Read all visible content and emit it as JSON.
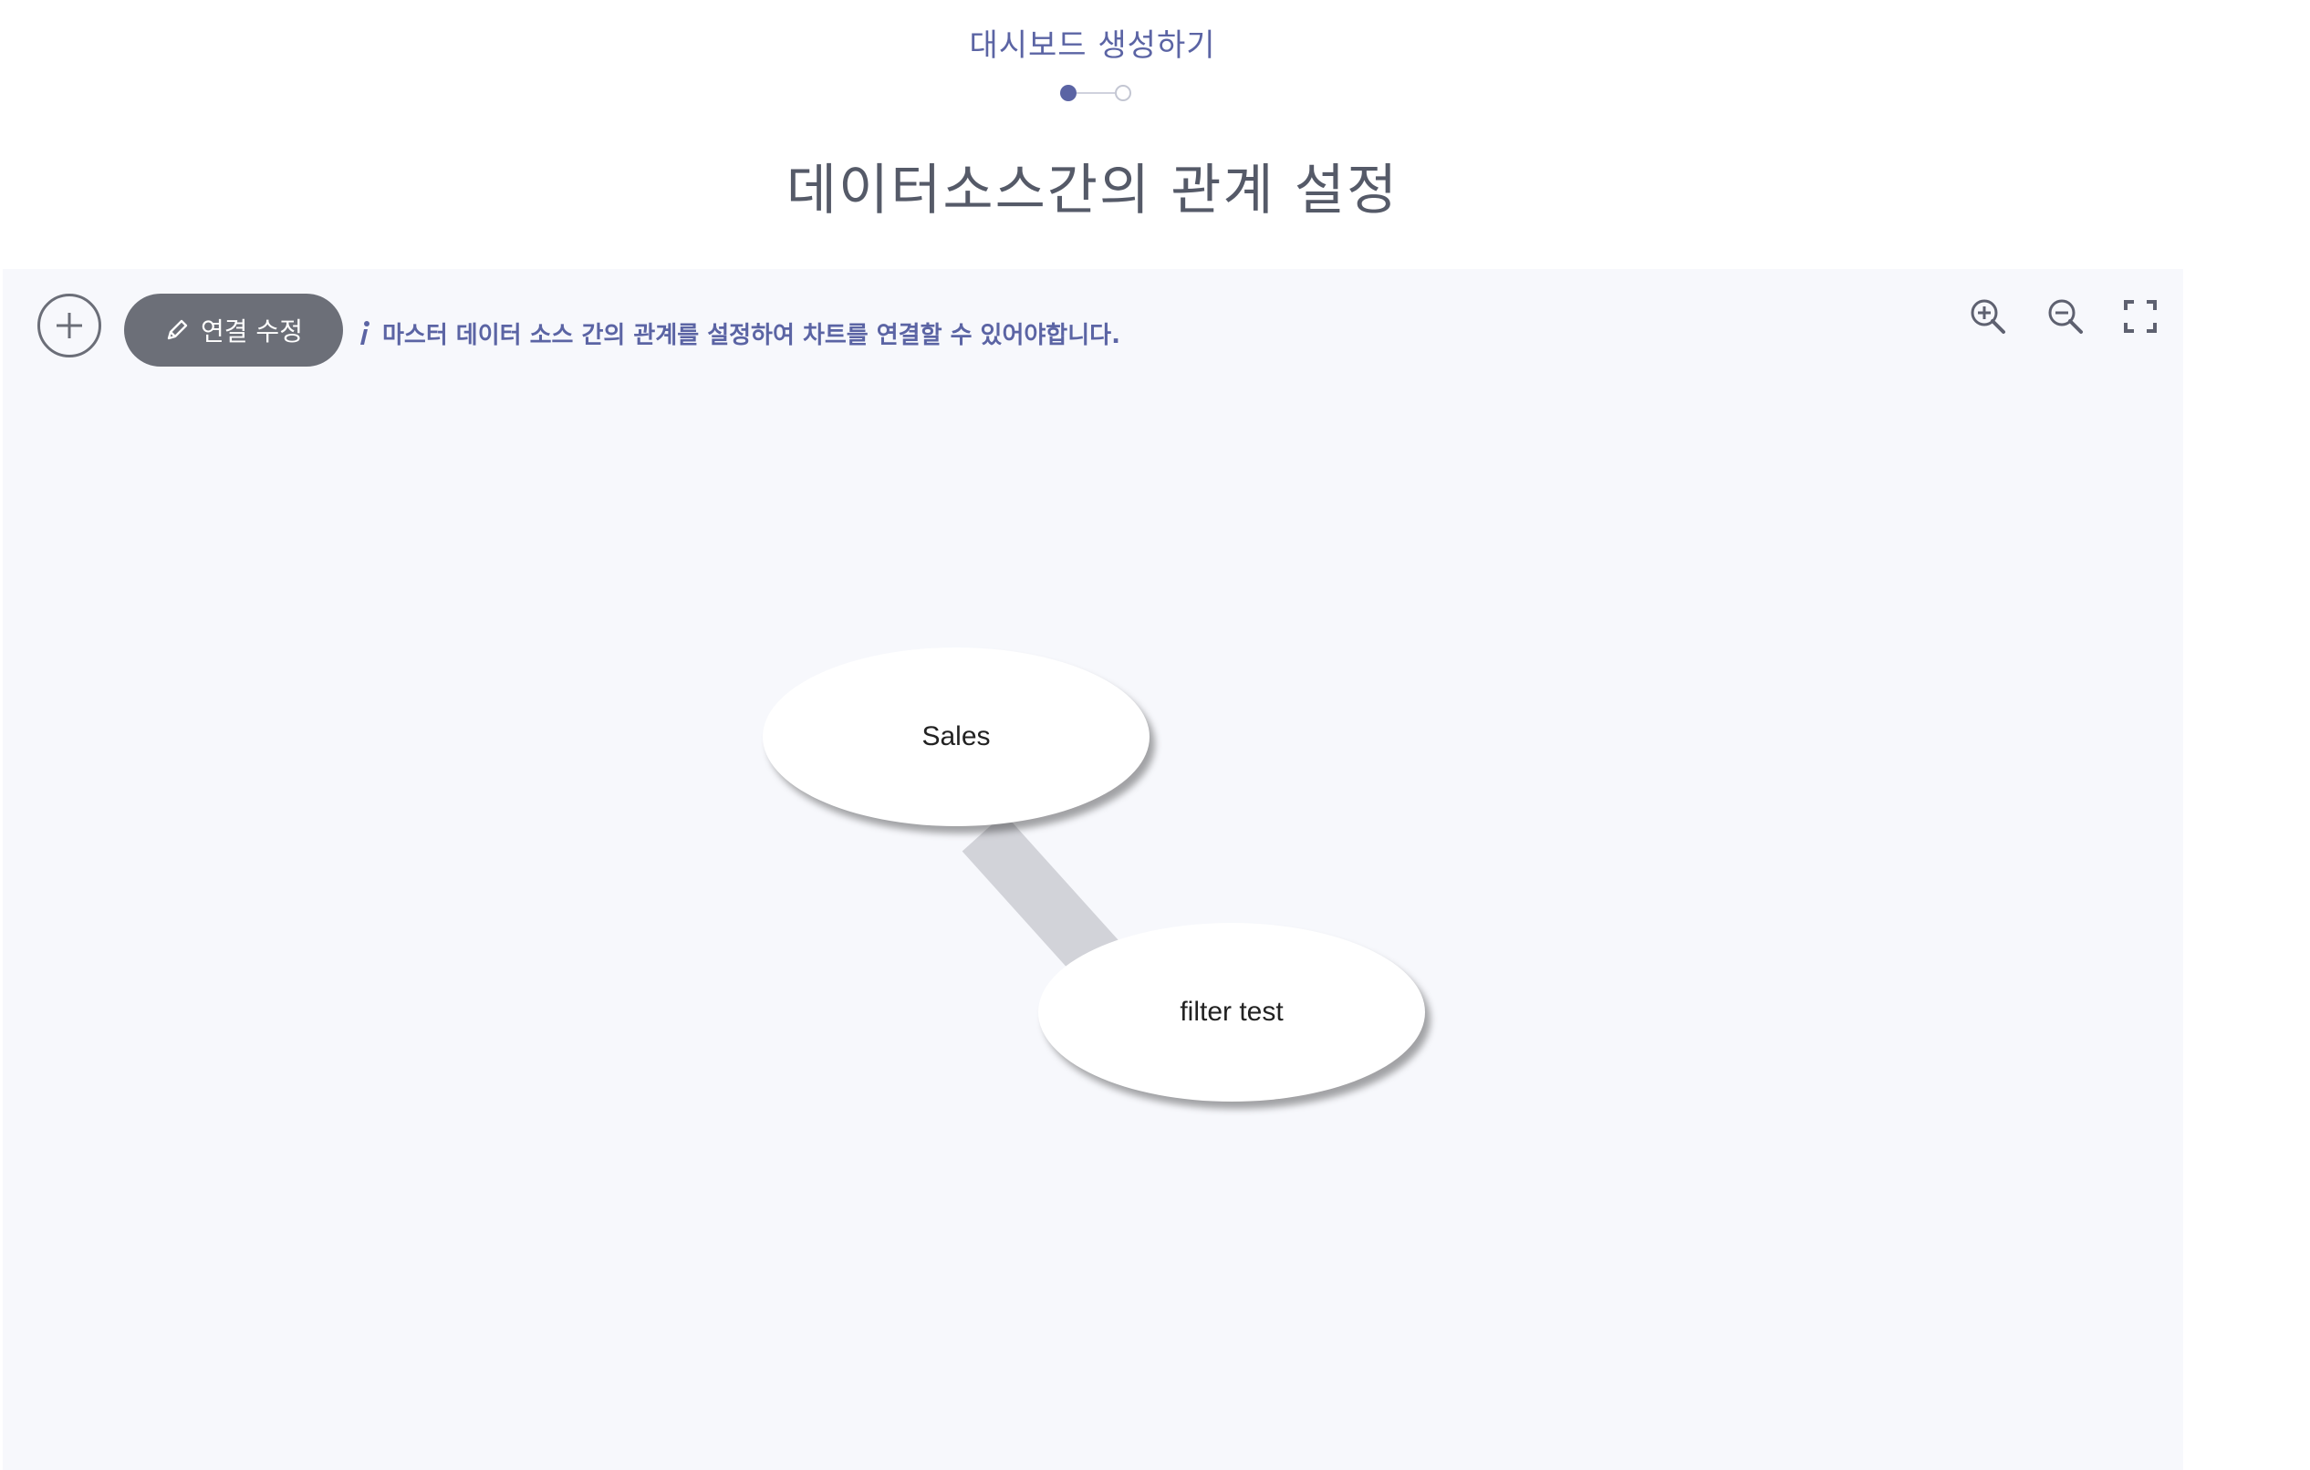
{
  "header": {
    "wizard_title": "대시보드 생성하기",
    "page_heading": "데이터소스간의 관계 설정",
    "steps": [
      {
        "state": "active"
      },
      {
        "state": "inactive"
      }
    ]
  },
  "toolbar": {
    "add_icon": "plus-circle-icon",
    "edit_link_label": "연결 수정",
    "edit_icon": "pencil-icon",
    "info_icon": "info-icon",
    "info_text": "마스터 데이터 소스 간의 관계를 설정하여 차트를 연결할 수 있어야합니다.",
    "zoom_in_icon": "zoom-in-icon",
    "zoom_out_icon": "zoom-out-icon",
    "fullscreen_icon": "fullscreen-icon"
  },
  "graph": {
    "nodes": [
      {
        "label": "Sales"
      },
      {
        "label": "filter test"
      }
    ],
    "edges": [
      {
        "from": "Sales",
        "to": "filter test"
      }
    ]
  },
  "colors": {
    "accent": "#5b64a4",
    "button_bg": "#6c6f78",
    "canvas_bg": "#f7f8fc",
    "edge": "#d2d3d9"
  }
}
